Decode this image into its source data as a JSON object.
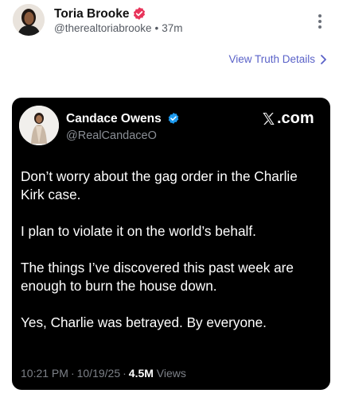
{
  "post": {
    "author_name": "Toria Brooke",
    "handle": "@therealtoriabrooke",
    "separator": "•",
    "time_ago": "37m",
    "more_icon": "more-vertical-icon",
    "verified_color": "#e8345a"
  },
  "truth_link": {
    "label": "View Truth Details",
    "icon": "chevron-right-icon",
    "color": "#5a62c8"
  },
  "embedded_tweet": {
    "name": "Candace Owens",
    "handle": "@RealCandaceO",
    "verified_color": "#1d9bf0",
    "source": ".com",
    "source_icon": "x-logo-icon",
    "paragraphs": [
      "Don’t worry about the gag order in the Charlie Kirk case.",
      "I plan to violate it on the world’s behalf.",
      "The things I’ve discovered this past week are enough to burn the house down.",
      "Yes, Charlie was betrayed. By everyone."
    ],
    "time": "10:21 PM",
    "date": "10/19/25",
    "views_count": "4.5M",
    "views_label": "Views",
    "sep": "·"
  }
}
